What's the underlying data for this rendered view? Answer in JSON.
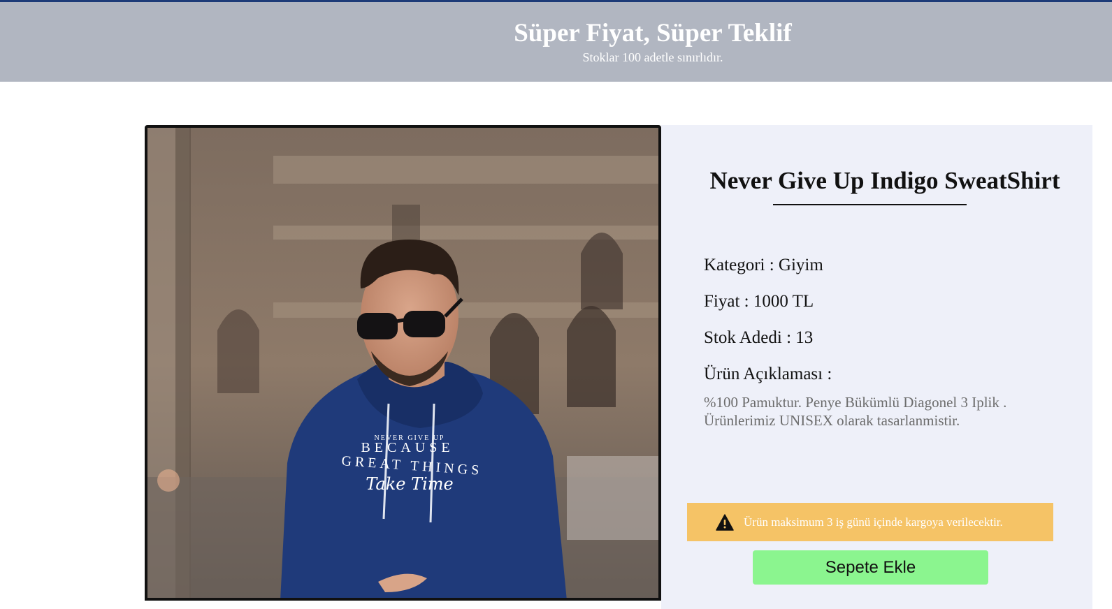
{
  "banner": {
    "title": "Süper Fiyat, Süper Teklif",
    "subtitle": "Stoklar 100 adetle sınırlıdır."
  },
  "product": {
    "title": "Never Give Up Indigo SweatShirt",
    "category": "Kategori : Giyim",
    "price": "Fiyat : 1000 TL",
    "stock": "Stok Adedi : 13",
    "description_label": "Ürün Açıklaması :",
    "description": "%100 Pamuktur. Penye Bükümlü Diagonel 3 Iplik . Ürünlerimiz UNISEX olarak tasarlanmistir.",
    "image": {
      "shirt_print": [
        "NEVER GIVE UP",
        "BECAUSE",
        "GREAT THINGS",
        "Take Time"
      ]
    }
  },
  "notice": {
    "icon": "warning-icon",
    "text": "Ürün maksimum 3 iş günü içinde kargoya verilecektir."
  },
  "actions": {
    "add_to_cart": "Sepete Ekle"
  },
  "colors": {
    "banner": "#b1b6c1",
    "top_line": "#1d3b78",
    "panel": "#eef0f9",
    "alert": "#f5c366",
    "cart_button": "#8bf58f",
    "hoodie": "#1f3a7a"
  }
}
